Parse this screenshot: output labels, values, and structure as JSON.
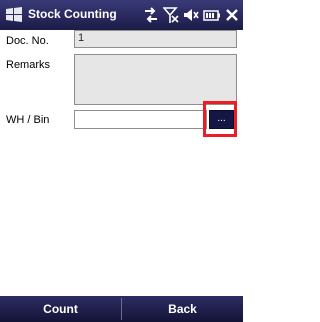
{
  "titlebar": {
    "title": "Stock Counting",
    "icons": [
      "windows-logo-icon",
      "connectivity-icon",
      "no-signal-icon",
      "volume-muted-icon",
      "battery-icon",
      "close-icon"
    ],
    "close_label": "✖"
  },
  "form": {
    "doc_no": {
      "label": "Doc. No.",
      "value": "1"
    },
    "remarks": {
      "label": "Remarks",
      "value": ""
    },
    "wh_bin": {
      "label": "WH / Bin",
      "value": "",
      "button_label": "..."
    }
  },
  "softkeys": {
    "left": "Count",
    "right": "Back"
  },
  "colors": {
    "titlebar": "#1c1c48",
    "softkeys": "#141438",
    "highlight": "#ee1c24",
    "readonly_field": "#e6e6e6"
  }
}
